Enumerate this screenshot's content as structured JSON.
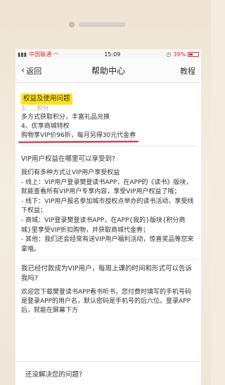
{
  "status_bar": {
    "carrier": "中国联通",
    "time": "15:09",
    "battery_pct": "39%",
    "battery_level": 0.39
  },
  "nav": {
    "back_label": "返回",
    "title": "帮助中心",
    "right_label": "教程"
  },
  "section1": {
    "title": "权益及使用问题",
    "faded_line": "3、…积分",
    "lines": [
      "多方式获取积分，丰富礼品兑换",
      "4、优享商城特权",
      "购物享VIP价96折，每月另得30元代金券"
    ]
  },
  "section2": {
    "question": "VIP用户权益在哪里可以享受到?",
    "answer": [
      "我们有多种方式让VIP用户享受权益",
      "- 线上：VIP用户登录樊登读书APP，在APP的《读书》版块，就能查看所有VIP用户专享内容，享受VIP用户权益了哦；",
      "- 线下：VIP用户报名参加城市授权点举办的读书活动，享受线下权益；",
      "- 商城：VIP登录樊登读书APP，在APP{我的}版块{积分商城}里享受VIP折扣购物，并获取商城代金券；",
      "- 其他：我们还会经常有送VIP用户福利活动，惊喜奖品等您来拿哦。"
    ]
  },
  "section3": {
    "question": "我已经付款成为VIP用户，每周上课的时间和形式可以告诉我吗?",
    "answer": "欢迎您下载樊登读书APP看书听书，您付费时填写的手机号码是登录APP的用户名，默认密码是手机号的后六位。登录APP后，就能在屏幕下方"
  },
  "bottom": {
    "help_label": "还没解决您的问题?"
  }
}
